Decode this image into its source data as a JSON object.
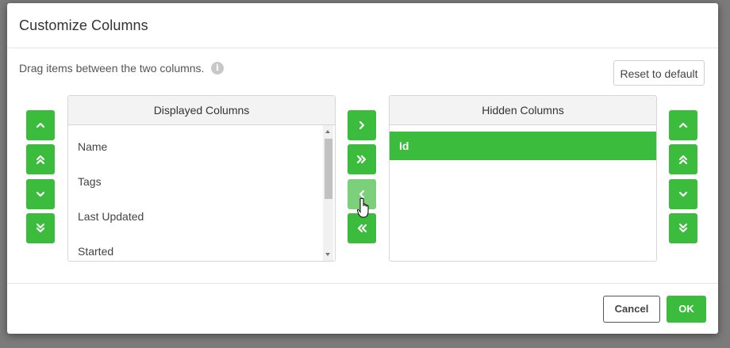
{
  "dialog": {
    "title": "Customize Columns",
    "instructions": "Drag items between the two columns.",
    "reset_label": "Reset to default"
  },
  "displayed": {
    "header": "Displayed Columns",
    "items": [
      "Name",
      "Tags",
      "Last Updated",
      "Started"
    ]
  },
  "hidden": {
    "header": "Hidden Columns",
    "items": [
      "Id"
    ],
    "selected": "Id"
  },
  "footer": {
    "cancel_label": "Cancel",
    "ok_label": "OK"
  },
  "colors": {
    "accent": "#3cbc3c",
    "accent_hover": "#7cd07c"
  }
}
